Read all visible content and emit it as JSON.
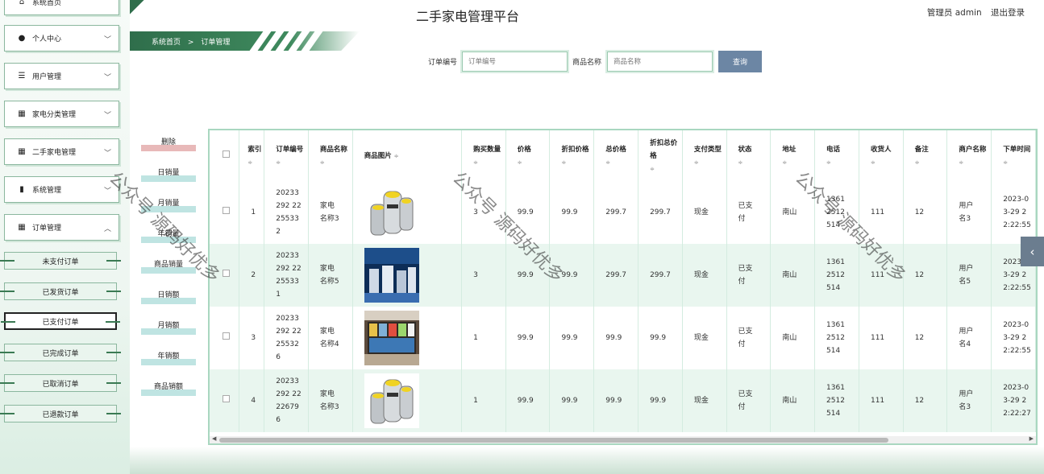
{
  "app": {
    "title": "二手家电管理平台"
  },
  "user": {
    "label": "管理员 admin",
    "logout": "退出登录"
  },
  "breadcrumb": [
    "系统首页",
    ">",
    "订单管理"
  ],
  "sidebar": {
    "top_item": "系统首页",
    "menus": [
      {
        "label": "个人中心",
        "icon": "person-icon"
      },
      {
        "label": "用户管理",
        "icon": "sliders-icon"
      },
      {
        "label": "家电分类管理",
        "icon": "grid-icon"
      },
      {
        "label": "二手家电管理",
        "icon": "grid-icon"
      },
      {
        "label": "系统管理",
        "icon": "bar-chart-icon"
      },
      {
        "label": "订单管理",
        "icon": "grid-icon"
      }
    ],
    "sub_items": [
      "未支付订单",
      "已发货订单",
      "已支付订单",
      "已完成订单",
      "已取消订单",
      "已退款订单"
    ]
  },
  "search": {
    "order_label": "订单编号",
    "order_placeholder": "订单编号",
    "product_label": "商品名称",
    "product_placeholder": "商品名称",
    "button": "查询"
  },
  "stat_buttons": [
    "删除",
    "日销量",
    "月销量",
    "年销量",
    "商品销量",
    "日销额",
    "月销额",
    "年销额",
    "商品销额"
  ],
  "table": {
    "headers": [
      "索引",
      "订单编号",
      "商品名称",
      "商品图片",
      "购买数量",
      "价格",
      "折扣价格",
      "总价格",
      "折扣总价格",
      "支付类型",
      "状态",
      "地址",
      "电话",
      "收货人",
      "备注",
      "商户名称",
      "下单时间"
    ],
    "rows": [
      {
        "idx": "1",
        "order_no": "20233292 22255332",
        "name": "家电名称3",
        "image": "silver-appliance",
        "qty": "3",
        "price": "99.9",
        "disc_price": "99.9",
        "total": "299.7",
        "disc_total": "299.7",
        "pay": "现金",
        "status": "已支付",
        "addr": "南山",
        "phone": "1361 2512 514",
        "receiver": "111",
        "note": "12",
        "merchant": "用户名3",
        "time": "2023-03-29 22:22:55"
      },
      {
        "idx": "2",
        "order_no": "20233292 22255331",
        "name": "家电名称5",
        "image": "appliance-store",
        "qty": "3",
        "price": "99.9",
        "disc_price": "99.9",
        "total": "299.7",
        "disc_total": "299.7",
        "pay": "现金",
        "status": "已支付",
        "addr": "南山",
        "phone": "1361 2512 514",
        "receiver": "111",
        "note": "12",
        "merchant": "用户名5",
        "time": "2023-03-29 22:22:55"
      },
      {
        "idx": "3",
        "order_no": "20233292 22255326",
        "name": "家电名称4",
        "image": "shop-shelves",
        "qty": "1",
        "price": "99.9",
        "disc_price": "99.9",
        "total": "99.9",
        "disc_total": "99.9",
        "pay": "现金",
        "status": "已支付",
        "addr": "南山",
        "phone": "1361 2512 514",
        "receiver": "111",
        "note": "12",
        "merchant": "用户名4",
        "time": "2023-03-29 22:22:55"
      },
      {
        "idx": "4",
        "order_no": "20233292 22226796",
        "name": "家电名称3",
        "image": "silver-appliance",
        "qty": "1",
        "price": "99.9",
        "disc_price": "99.9",
        "total": "99.9",
        "disc_total": "99.9",
        "pay": "现金",
        "status": "已支付",
        "addr": "南山",
        "phone": "1361 2512 514",
        "receiver": "111",
        "note": "12",
        "merchant": "用户名3",
        "time": "2023-03-29 22:22:27"
      }
    ]
  },
  "watermark": "公众号 源码好优多"
}
